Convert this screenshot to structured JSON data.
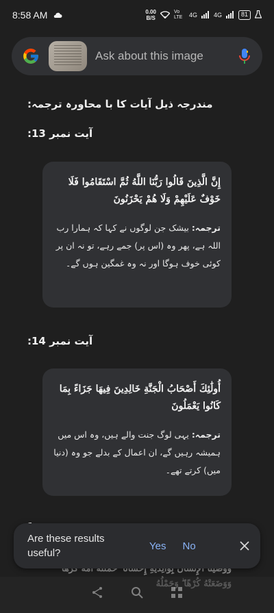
{
  "status_bar": {
    "time": "8:58 AM",
    "speed_value": "0.00",
    "speed_unit": "B/S",
    "network_1": "Vo LTE",
    "signal_1": "4G",
    "signal_2": "4G",
    "battery": "81"
  },
  "search": {
    "placeholder": "Ask about this image"
  },
  "content": {
    "intro_heading": "مندرجہ ذیل آیات کا با محاورہ ترجمہ:",
    "ayah_13_heading": "آیت نمبر 13:",
    "ayah_13_arabic": "إِنَّ الَّذِينَ قَالُوا رَبُّنَا اللَّهُ ثُمَّ اسْتَقَامُوا فَلَا خَوْفٌ عَلَيْهِمْ وَلَا هُمْ يَحْزَنُونَ",
    "ayah_13_label": "ترجمہ:",
    "ayah_13_translation": " بیشک جن لوگوں نے کہا کہ ہمارا رب اللہ ہے، پھر وہ (اس پر) جمے رہے، تو نہ ان پر کوئی خوف ہوگا اور نہ وہ غمگین ہوں گے۔",
    "ayah_14_heading": "آیت نمبر 14:",
    "ayah_14_arabic": "أُولَٰئِكَ أَصْحَابُ الْجَنَّةِ خَالِدِينَ فِيهَا جَزَاءً بِمَا كَانُوا يَعْمَلُونَ",
    "ayah_14_label": "ترجمہ:",
    "ayah_14_translation": " یہی لوگ جنت والے ہیں، وہ اس میں ہمیشہ رہیں گے، ان اعمال کے بدلے جو وہ (دنیا میں) کرتے تھے۔",
    "ayah_15_partial": "1",
    "ayah_15_arabic_partial": "وَوَصَّيْنَا الْإِنسَانَ بِوَالِدَيْهِ إِحْسَانًا ۖ حَمَلَتْهُ أُمُّهُ كُرْهًا وَوَضَعَتْهُ كُرْهًا ۖ وَحَمْلُهُ"
  },
  "feedback": {
    "question": "Are these results useful?",
    "yes_label": "Yes",
    "no_label": "No"
  },
  "colors": {
    "background": "#1f1f1f",
    "card": "#303134",
    "link": "#8ab4f8"
  }
}
